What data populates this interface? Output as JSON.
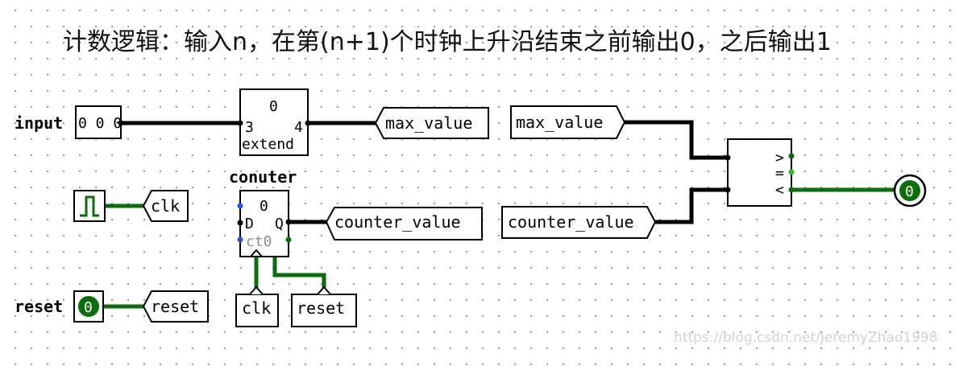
{
  "title": "计数逻辑：输入n，在第(n+1)个时钟上升沿结束之前输出0，之后输出1",
  "pins": {
    "input_label": "input",
    "input_value": "0 0 0",
    "reset_label": "reset",
    "reset_value": "0",
    "output_value": "0"
  },
  "extender": {
    "top_label": "0",
    "in_width": "3",
    "out_width": "4",
    "name": "extend"
  },
  "counter": {
    "name": "conuter",
    "top_value": "0",
    "d_label": "D",
    "q_label": "Q",
    "ct_label": "ct0"
  },
  "tunnels": {
    "max_value_out": "max_value",
    "max_value_in": "max_value",
    "clk_out": "clk",
    "clk_in": "clk",
    "reset_out": "reset",
    "reset_in": "reset",
    "counter_value_out": "counter_value",
    "counter_value_in": "counter_value"
  },
  "comparator": {
    "gt": ">",
    "eq": "=",
    "lt": "<"
  },
  "watermark": "https://blog.csdn.net/JeremyZhao1998",
  "colors": {
    "wire": "#000000",
    "active_wire": "#0a6e0a",
    "pin_dot": "#3050e0"
  }
}
